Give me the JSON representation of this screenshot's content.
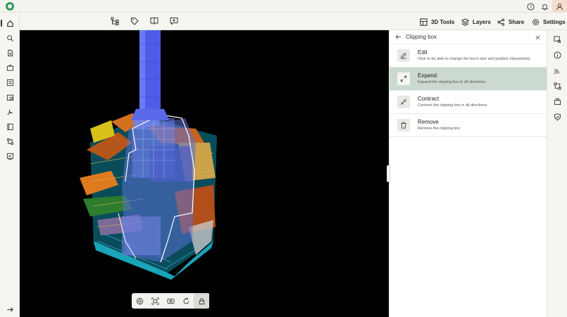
{
  "topbar": {
    "icons": [
      "logo-icon",
      "help-icon",
      "bell-icon",
      "user-icon"
    ]
  },
  "toolbar": {
    "icons": [
      "hierarchy-icon",
      "tag-icon",
      "compare-icon",
      "comment-icon"
    ],
    "tools_3d_label": "3D Tools",
    "layers_label": "Layers",
    "share_label": "Share",
    "settings_label": "Settings"
  },
  "sidebar": {
    "items": [
      "home-icon",
      "search-icon",
      "document-icon",
      "briefcase-icon",
      "list-icon",
      "calendar-check-icon",
      "tools-icon",
      "book-icon",
      "workflow-icon",
      "checklist-icon"
    ],
    "collapse_icon": "arrow-right-icon"
  },
  "clipping_panel": {
    "title": "Clipping box",
    "options": [
      {
        "title": "Edit",
        "desc": "Click to be able to change the box's size and position interactively",
        "icon": "pencil-icon"
      },
      {
        "title": "Expand",
        "desc": "Expand the clipping box in all directions",
        "icon": "expand-icon"
      },
      {
        "title": "Contract",
        "desc": "Contract the clipping box in all directions",
        "icon": "contract-icon"
      },
      {
        "title": "Remove",
        "desc": "Remove the clipping box",
        "icon": "trash-icon"
      }
    ]
  },
  "rightbar": {
    "items": [
      "window-search-icon",
      "info-icon",
      "signal-icon",
      "transform-icon",
      "layers-box-icon",
      "badge-check-icon"
    ]
  },
  "viewer_tools": [
    "orbit-icon",
    "fit-icon",
    "view-icon",
    "reset-icon",
    "lock-icon"
  ],
  "colors": {
    "accent_selected": "#ccd9cf",
    "viewport_bg": "#000000",
    "logo_green": "#2c9a5b"
  }
}
